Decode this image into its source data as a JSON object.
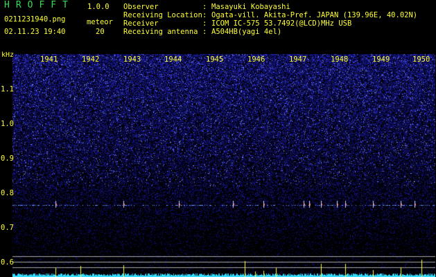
{
  "app": {
    "name": "HROFFT",
    "version": "1.0.0"
  },
  "file": {
    "name": "0211231940.png",
    "datetime": "02.11.23 19:40"
  },
  "meteor": {
    "label": "meteor",
    "count": "20"
  },
  "info": [
    {
      "key": "Observer",
      "value": "Masayuki Kobayashi"
    },
    {
      "key": "Receiving Location",
      "value": "Ogata-vill. Akita-Pref. JAPAN (139.96E, 40.02N)"
    },
    {
      "key": "Receiver",
      "value": "ICOM IC-575 53.7492(@LCD)MHz USB"
    },
    {
      "key": "Receiving antenna",
      "value": "A504HB(yagi 4el)"
    }
  ],
  "colon": ":",
  "axis": {
    "unit": "kHz",
    "time_labels": [
      "1941",
      "1942",
      "1943",
      "1944",
      "1945",
      "1946",
      "1947",
      "1948",
      "1949",
      "1950"
    ],
    "freq_labels": [
      "1.1",
      "1.0",
      "0.9",
      "0.8",
      "0.7",
      "0.6"
    ]
  },
  "colors": {
    "text": "#ffff33",
    "appname": "#33dd55",
    "background": "#000000",
    "noise": "#1a1aa8",
    "trace": "#33ccff"
  }
}
